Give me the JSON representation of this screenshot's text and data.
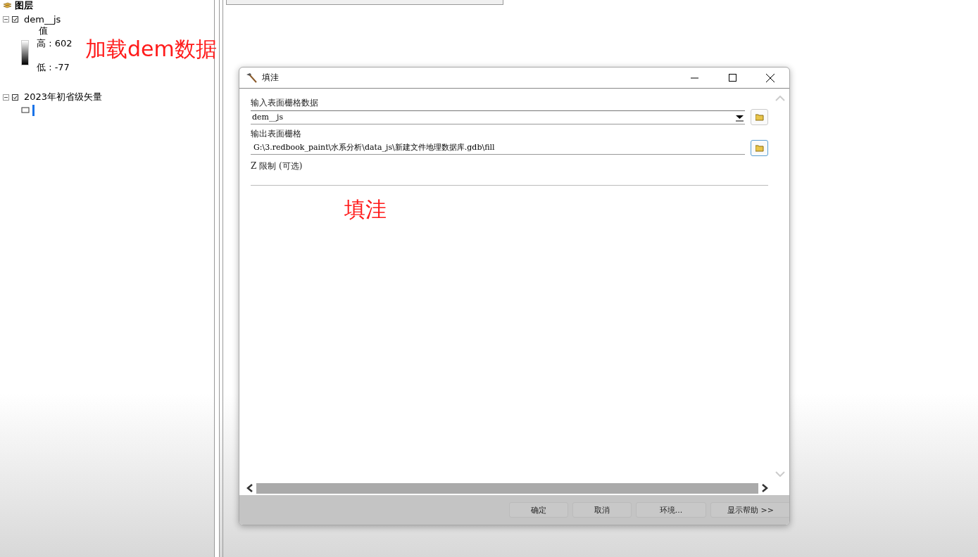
{
  "toc": {
    "title": "图层",
    "layers": [
      {
        "name": "dem__js",
        "checked": true,
        "expanded": true,
        "kind": "raster",
        "legend": {
          "heading": "值",
          "high": "高 : 602",
          "low": "低 : -77"
        }
      },
      {
        "name": "2023年初省级矢量",
        "checked": true,
        "expanded": true,
        "kind": "polygon"
      }
    ]
  },
  "annotations": [
    {
      "text": "加载dem数据",
      "kind": "label"
    },
    {
      "text": "填洼",
      "kind": "label"
    }
  ],
  "dialog": {
    "title": "填洼",
    "params": [
      {
        "label": "输入表面栅格数据",
        "value": "dem__js",
        "kind": "dropdown"
      },
      {
        "label": "输出表面栅格",
        "value": "G:\\3.redbook_paint\\水系分析\\data_js\\新建文件地理数据库.gdb\\fill",
        "kind": "path"
      },
      {
        "label": "Z 限制 (可选)",
        "kind": "section"
      }
    ],
    "buttons": [
      "确定",
      "取消",
      "环境...",
      "显示帮助 >>"
    ]
  }
}
